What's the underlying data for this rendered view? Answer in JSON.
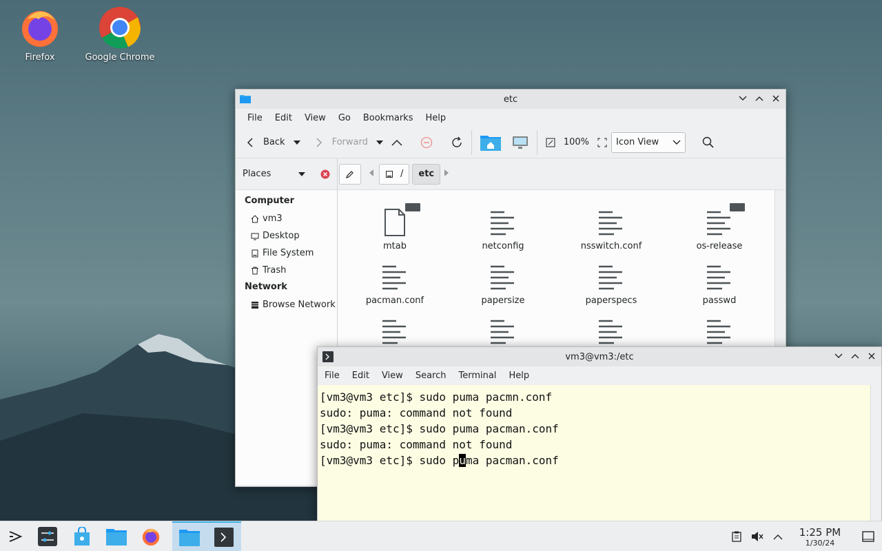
{
  "desktop": {
    "icons": [
      {
        "label": "Firefox",
        "icon": "firefox-icon"
      },
      {
        "label": "Google Chrome",
        "icon": "chrome-icon"
      }
    ]
  },
  "file_manager": {
    "title": "etc",
    "menu": [
      "File",
      "Edit",
      "View",
      "Go",
      "Bookmarks",
      "Help"
    ],
    "toolbar": {
      "back": "Back",
      "forward": "Forward",
      "zoom": "100%",
      "view_mode": "Icon View"
    },
    "places_label": "Places",
    "breadcrumb": {
      "root": "/",
      "current": "etc"
    },
    "sidebar": {
      "computer_heading": "Computer",
      "computer_items": [
        "vm3",
        "Desktop",
        "File System",
        "Trash"
      ],
      "network_heading": "Network",
      "network_items": [
        "Browse Network"
      ]
    },
    "files": [
      "mtab",
      "netconfig",
      "nsswitch.conf",
      "os-release",
      "pacman.conf",
      "papersize",
      "paperspecs",
      "passwd"
    ]
  },
  "terminal": {
    "title": "vm3@vm3:/etc",
    "menu": [
      "File",
      "Edit",
      "View",
      "Search",
      "Terminal",
      "Help"
    ],
    "lines": [
      "[vm3@vm3 etc]$ sudo puma pacmn.conf",
      "sudo: puma: command not found",
      "[vm3@vm3 etc]$ sudo puma pacman.conf",
      "sudo: puma: command not found"
    ],
    "current_prefix": "[vm3@vm3 etc]$ sudo p",
    "current_cursor_char": "u",
    "current_suffix": "ma pacman.conf"
  },
  "taskbar": {
    "time": "1:25 PM",
    "date": "1/30/24"
  }
}
